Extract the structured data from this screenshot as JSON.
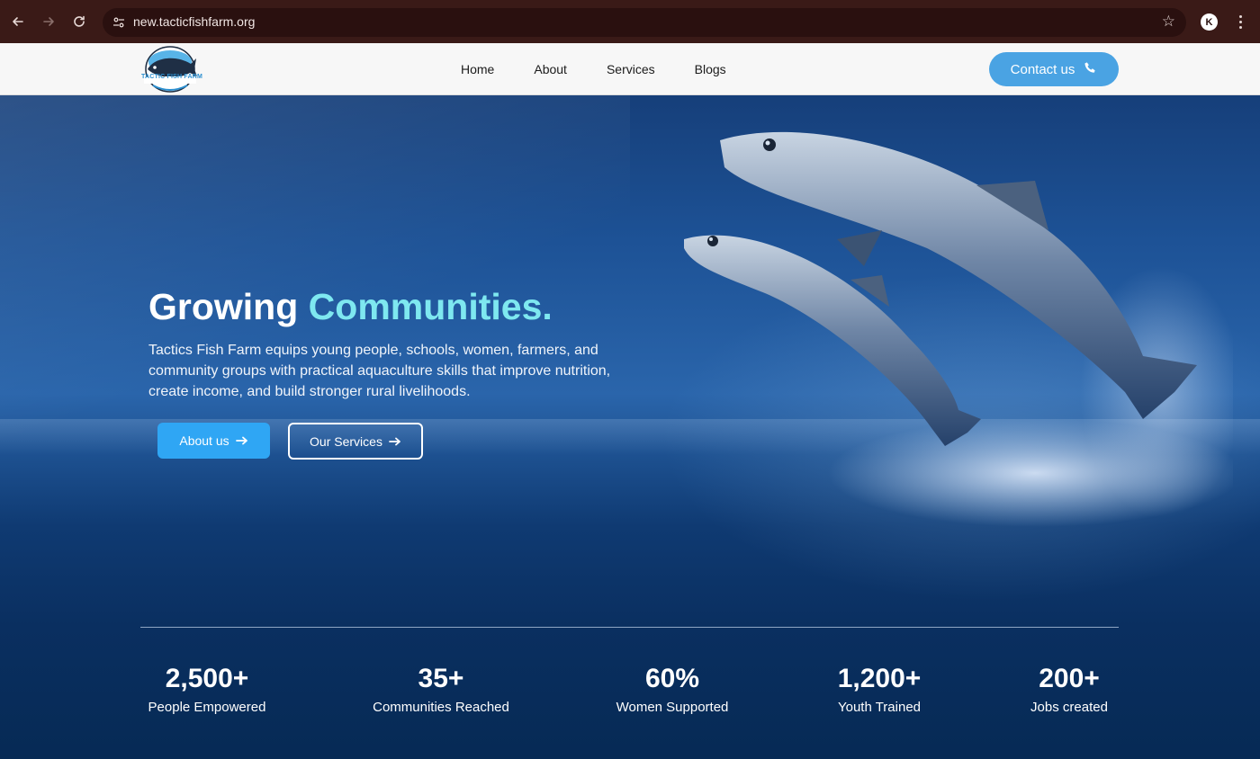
{
  "browser": {
    "url": "new.tacticfishfarm.org",
    "back_icon": "arrow-left-icon",
    "forward_icon": "arrow-right-icon",
    "reload_icon": "reload-icon",
    "bookmark_icon": "star-icon"
  },
  "header": {
    "logo_text": "TACTIC FISH FARM",
    "nav": [
      "Home",
      "About",
      "Services",
      "Blogs"
    ],
    "contact_label": "Contact us"
  },
  "hero": {
    "title_main": "Growing",
    "title_accent": "Communities.",
    "description": "Tactics Fish Farm equips young people, schools, women, farmers, and community groups with practical aquaculture skills that improve nutrition, create income, and build stronger rural livelihoods.",
    "primary_button": "About us",
    "secondary_button": "Our Services"
  },
  "stats": [
    {
      "value": "2,500+",
      "label": "People Empowered"
    },
    {
      "value": "35+",
      "label": "Communities Reached"
    },
    {
      "value": "60%",
      "label": "Women Supported"
    },
    {
      "value": "1,200+",
      "label": "Youth Trained"
    },
    {
      "value": "200+",
      "label": "Jobs created"
    }
  ],
  "colors": {
    "accent": "#7ee8f0",
    "button_primary": "#2fa6f4",
    "contact_button": "#4aa3e3",
    "hero_bottom": "#062a55"
  }
}
